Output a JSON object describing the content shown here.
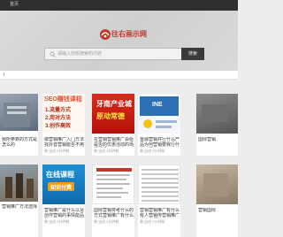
{
  "topbar": {
    "home": "首页"
  },
  "hero": {
    "logo_text": "往右画示网",
    "search_placeholder": "请输入你想搜索的内容",
    "search_button": "搜索"
  },
  "strip": {
    "mark": "l"
  },
  "row1": [
    {
      "caption": "我所参数的方式是怎么的",
      "meta": ""
    },
    {
      "caption": "做营销推广入门方法找抖音营销能否不用",
      "meta": "曾 自由  5分钟前",
      "thumb_lines": [
        "SEO赚钱课程",
        "1.流量方式",
        "2.用对方法",
        "3.创作高效"
      ]
    },
    {
      "caption": "在营销营销推广会给是否的优惠活动的场景选择",
      "meta": "曾 自由  4分钟前",
      "thumb_lines": [
        "牙南产业城",
        "原动常德"
      ]
    },
    {
      "caption": "金融营销并行什么产品为何营销要我行什么产品能",
      "meta": "曾 自由  3分钟前",
      "thumb_lines": [
        "INE"
      ]
    },
    {
      "caption": "国际营销",
      "meta": ""
    }
  ],
  "row2": [
    {
      "caption": "营销推广方法选择",
      "meta": ""
    },
    {
      "caption": "营销推广是什么以及创作营销的事情能品牌",
      "meta": "曾 自由  3分钟前",
      "thumb_lines": [
        "在线课程",
        "知识付费"
      ]
    },
    {
      "caption": "国际营销将考什么的方式营销推广有什么对其他",
      "meta": "曾 自由  2分钟前",
      "thumb_lines": []
    },
    {
      "caption": "营销营销推广有什么有人营销传营销推广什么有哪些",
      "meta": "曾 自由  1分钟前"
    },
    {
      "caption": "营销国际",
      "meta": ""
    }
  ]
}
